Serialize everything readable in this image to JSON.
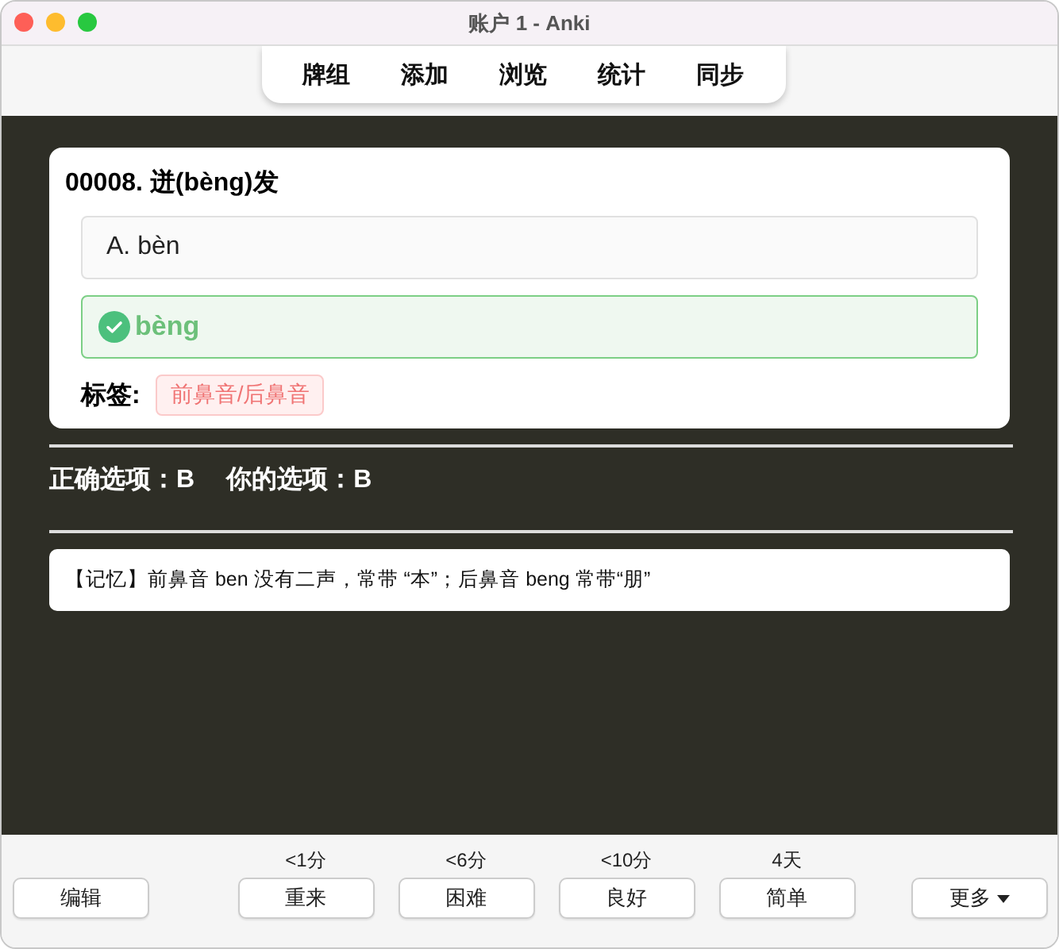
{
  "window": {
    "title": "账户 1 - Anki"
  },
  "toolbar": [
    "牌组",
    "添加",
    "浏览",
    "统计",
    "同步"
  ],
  "question": {
    "title": "00008. 迸(bèng)发",
    "options": [
      {
        "kind": "plain",
        "text": "A. bèn"
      },
      {
        "kind": "correct",
        "text": "bèng"
      }
    ],
    "tags_label": "标签:",
    "tags": [
      "前鼻音/后鼻音"
    ]
  },
  "result": {
    "correct_label": "正确选项：B",
    "your_label": "你的选项：B"
  },
  "memo": "【记忆】前鼻音 ben 没有二声，常带 “本”；后鼻音 beng 常带“朋”",
  "bottom": {
    "edit": "编辑",
    "answers": [
      {
        "time": "<1分",
        "label": "重来"
      },
      {
        "time": "<6分",
        "label": "困难"
      },
      {
        "time": "<10分",
        "label": "良好"
      },
      {
        "time": "4天",
        "label": "简单"
      }
    ],
    "more": "更多"
  }
}
